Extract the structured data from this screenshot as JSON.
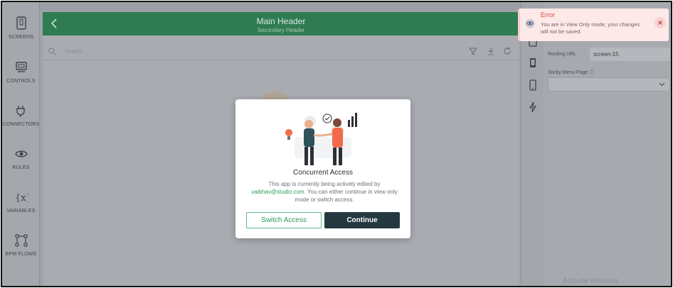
{
  "sidebar": {
    "items": [
      {
        "label": "SCREENS",
        "icon": "screens-icon"
      },
      {
        "label": "CONTROLS",
        "icon": "controls-icon"
      },
      {
        "label": "CONNECTORS",
        "icon": "connectors-icon"
      },
      {
        "label": "RULES",
        "icon": "rules-icon"
      },
      {
        "label": "VARIABLES",
        "icon": "variables-icon"
      },
      {
        "label": "BPM FLOWS",
        "icon": "bpm-flows-icon"
      }
    ]
  },
  "header": {
    "title": "Main Header",
    "subtitle": "Secondary Header",
    "color": "#2f7b52"
  },
  "search": {
    "placeholder": "Search"
  },
  "right_panel": {
    "routing_url_label": "Routing URL",
    "routing_url_value": "screen-15",
    "sticky_menu_label": "Sticky Menu Page ⓘ"
  },
  "watermark": "Activate Windows",
  "modal": {
    "title": "Concurrent Access",
    "text_before": "This app is currently being actively edited by",
    "email": "vaibhav@studio.com",
    "text_after": ". You can either continue in view only mode or switch access.",
    "switch_label": "Switch Access",
    "continue_label": "Continue",
    "accent": "#2c9a5c",
    "primary": "#24383f"
  },
  "toast": {
    "title": "Error",
    "message": "You are in View Only mode, your changes will not be saved.",
    "color": "#e0473f"
  }
}
